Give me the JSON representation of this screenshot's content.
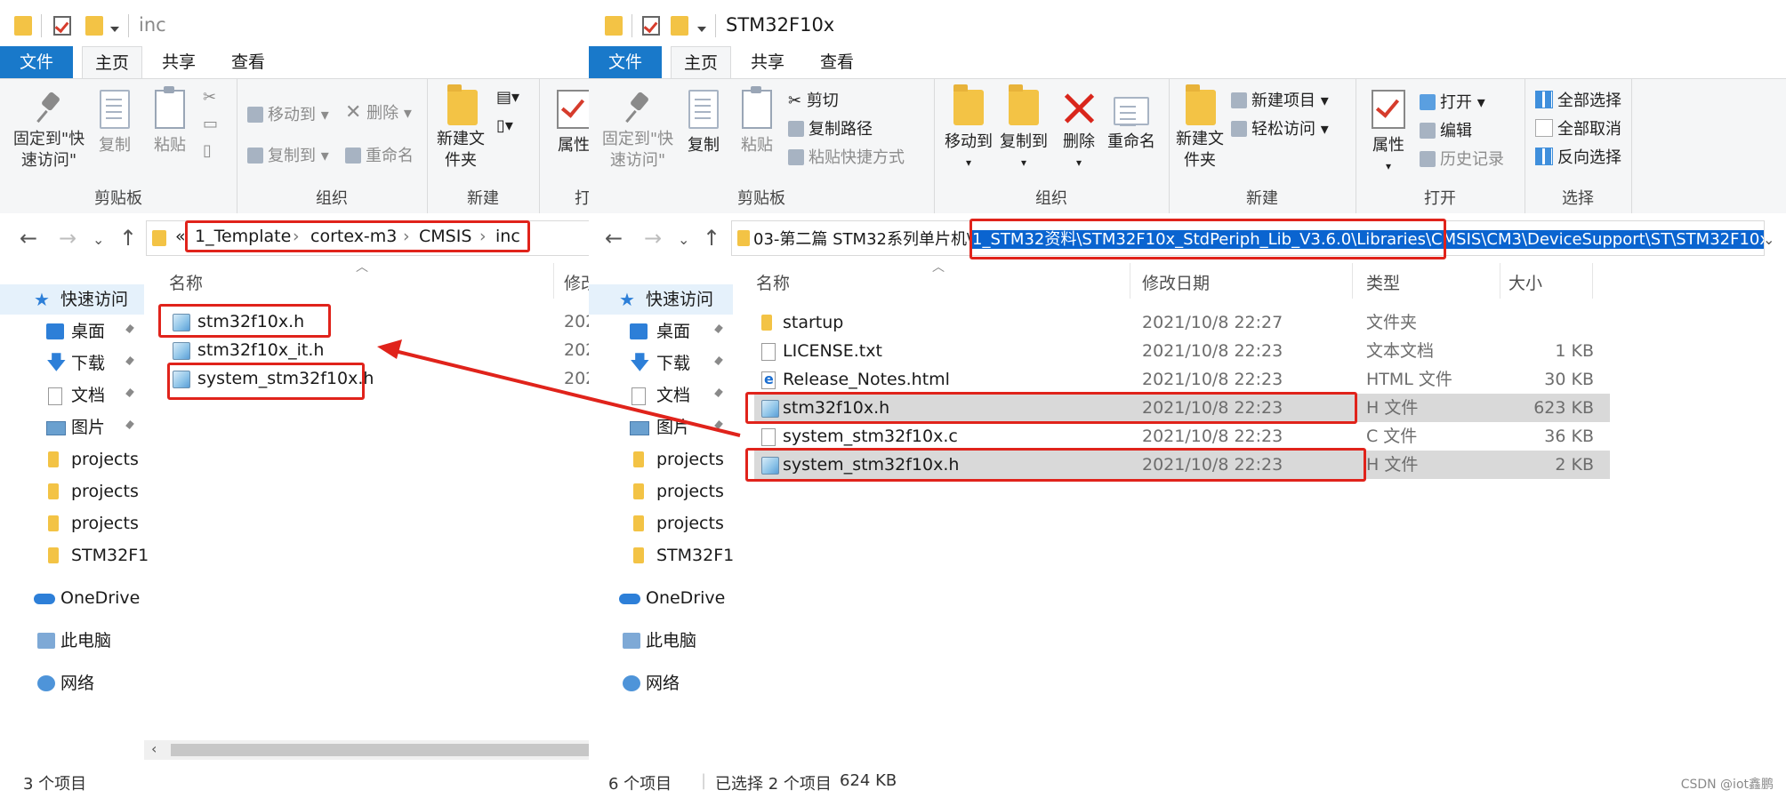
{
  "left": {
    "title": "inc",
    "tabs": {
      "file": "文件",
      "home": "主页",
      "share": "共享",
      "view": "查看"
    },
    "ribbon": {
      "pin": "固定到\"快速访问\"",
      "copy": "复制",
      "paste": "粘贴",
      "move_to": "移动到",
      "copy_to": "复制到",
      "delete": "删除",
      "rename": "重命名",
      "new_folder": "新建文件夹",
      "properties": "属性",
      "group_clipboard": "剪贴板",
      "group_organize": "组织",
      "group_new": "新建",
      "group_open": "打"
    },
    "breadcrumb": [
      "«",
      "1_Template",
      "cortex-m3",
      "CMSIS",
      "inc"
    ],
    "columns": {
      "name": "名称",
      "date": "修改"
    },
    "files": [
      {
        "name": "stm32f10x.h",
        "date": "202"
      },
      {
        "name": "stm32f10x_it.h",
        "date": "202"
      },
      {
        "name": "system_stm32f10x.h",
        "date": "202"
      }
    ],
    "status": "3 个项目"
  },
  "right": {
    "title": "STM32F10x",
    "tabs": {
      "file": "文件",
      "home": "主页",
      "share": "共享",
      "view": "查看"
    },
    "ribbon": {
      "pin": "固定到\"快速访问\"",
      "copy": "复制",
      "paste": "粘贴",
      "cut": "剪切",
      "copy_path": "复制路径",
      "paste_shortcut": "粘贴快捷方式",
      "move_to": "移动到",
      "copy_to": "复制到",
      "delete": "删除",
      "rename": "重命名",
      "new_folder": "新建文件夹",
      "new_item": "新建项目",
      "easy_access": "轻松访问",
      "properties": "属性",
      "open": "打开",
      "edit": "编辑",
      "history": "历史记录",
      "select_all": "全部选择",
      "select_none": "全部取消",
      "invert_selection": "反向选择",
      "group_clipboard": "剪贴板",
      "group_organize": "组织",
      "group_new": "新建",
      "group_open": "打开",
      "group_select": "选择"
    },
    "address_prefix": "03-第二篇 STM32系列单片机\\",
    "address_selected": "1_STM32资料\\STM32F10x_StdPeriph_Lib_V3.6.0\\Libraries\\CMSIS\\CM3\\DeviceSupport\\ST\\STM32F10x",
    "columns": {
      "name": "名称",
      "date": "修改日期",
      "type": "类型",
      "size": "大小"
    },
    "files": [
      {
        "name": "startup",
        "date": "2021/10/8 22:27",
        "type": "文件夹",
        "size": "",
        "icon": "folder-icon"
      },
      {
        "name": "LICENSE.txt",
        "date": "2021/10/8 22:23",
        "type": "文本文档",
        "size": "1 KB",
        "icon": "text-file-icon"
      },
      {
        "name": "Release_Notes.html",
        "date": "2021/10/8 22:23",
        "type": "HTML 文件",
        "size": "30 KB",
        "icon": "html-file-icon"
      },
      {
        "name": "stm32f10x.h",
        "date": "2021/10/8 22:23",
        "type": "H 文件",
        "size": "623 KB",
        "icon": "h-file-icon"
      },
      {
        "name": "system_stm32f10x.c",
        "date": "2021/10/8 22:23",
        "type": "C 文件",
        "size": "36 KB",
        "icon": "c-file-icon"
      },
      {
        "name": "system_stm32f10x.h",
        "date": "2021/10/8 22:23",
        "type": "H 文件",
        "size": "2 KB",
        "icon": "h-file-icon"
      }
    ],
    "status_count": "6 个项目",
    "status_selected": "已选择 2 个项目",
    "status_size": "624 KB"
  },
  "sidebar": {
    "items": [
      {
        "label": "快速访问",
        "icon": "star-icon"
      },
      {
        "label": "桌面",
        "icon": "desktop-icon"
      },
      {
        "label": "下载",
        "icon": "download-icon"
      },
      {
        "label": "文档",
        "icon": "documents-icon"
      },
      {
        "label": "图片",
        "icon": "pictures-icon"
      },
      {
        "label": "projects",
        "icon": "folder-icon"
      },
      {
        "label": "projects",
        "icon": "folder-icon"
      },
      {
        "label": "projects",
        "icon": "folder-icon"
      },
      {
        "label": "STM32F1",
        "icon": "folder-icon"
      },
      {
        "label": "OneDrive",
        "icon": "cloud-icon"
      },
      {
        "label": "此电脑",
        "icon": "computer-icon"
      },
      {
        "label": "网络",
        "icon": "network-icon"
      }
    ]
  },
  "watermark": "CSDN @iot鑫鹏",
  "colors": {
    "file_tab": "#1979ca",
    "highlight_box": "#e0231b",
    "selection": "#0a64d0",
    "row_selected": "#d9d9d9"
  }
}
